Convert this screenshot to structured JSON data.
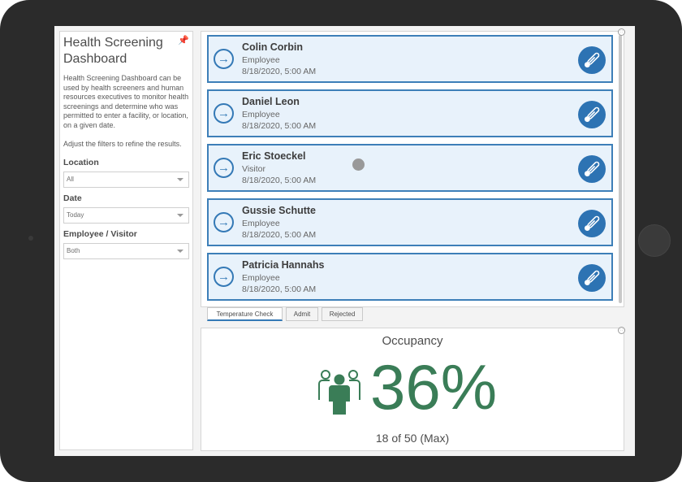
{
  "sidebar": {
    "title": "Health Screening Dashboard",
    "description": "Health Screening Dashboard can be used by health screeners and human resources executives to monitor health screenings and determine who was permitted to enter a facility, or location, on a given date.",
    "hint": "Adjust the filters to refine the results.",
    "filters": [
      {
        "label": "Location",
        "value": "All"
      },
      {
        "label": "Date",
        "value": "Today"
      },
      {
        "label": "Employee / Visitor",
        "value": "Both"
      }
    ]
  },
  "list": {
    "items": [
      {
        "name": "Colin Corbin",
        "role": "Employee",
        "time": "8/18/2020, 5:00 AM"
      },
      {
        "name": "Daniel Leon",
        "role": "Employee",
        "time": "8/18/2020, 5:00 AM"
      },
      {
        "name": "Eric Stoeckel",
        "role": "Visitor",
        "time": "8/18/2020, 5:00 AM"
      },
      {
        "name": "Gussie Schutte",
        "role": "Employee",
        "time": "8/18/2020, 5:00 AM"
      },
      {
        "name": "Patricia Hannahs",
        "role": "Employee",
        "time": "8/18/2020, 5:00 AM"
      }
    ]
  },
  "tabs": [
    {
      "label": "Temperature Check",
      "active": true
    },
    {
      "label": "Admit",
      "active": false
    },
    {
      "label": "Rejected",
      "active": false
    }
  ],
  "occupancy": {
    "title": "Occupancy",
    "percent": "36%",
    "detail": "18 of 50 (Max)"
  },
  "colors": {
    "accent": "#3479b6",
    "occupancy": "#3a7d57"
  },
  "icons": {
    "arrow": "arrow-right-circle-icon",
    "thermometer": "thermometer-icon",
    "people": "people-group-icon",
    "pin": "pin-icon"
  }
}
